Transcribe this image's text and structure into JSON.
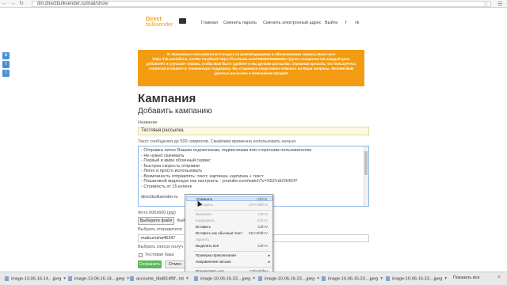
{
  "browser": {
    "url": "dm.directbulksender.ru/mail/show",
    "back_icon": "arrow-left",
    "forward_icon": "arrow-right",
    "reload_icon": "reload",
    "star_icon": "star",
    "menu_icon": "hamburger"
  },
  "site": {
    "logo_line1": "Direct",
    "logo_line2": "bulksender",
    "nav": [
      "Главная",
      "Сменить пароль",
      "Сменить электронный адрес",
      "Выйти"
    ],
    "social": [
      "f",
      "vk"
    ]
  },
  "notice": "!!! Уважаемые пользователи! Следите за рекомендациями и обновлениями сервиса Вконтакте https://vk.com/direct_sender Facebook https://facebook.com/106394766865481 Группа специалистов каждый день добавляет и улучшает сервис, чтобы Вам было удобнее и мы делаем рассылки. Огромная просьба, что пользуетесь сервисом и пишите в техническую поддержку. Мы стараемся оперативно отвечать на Ваши вопросы. Желаем Вам удачных рассылок и повышения продаж!",
  "page": {
    "title": "Кампания",
    "subtitle": "Добавить кампанию",
    "name_label": "Название",
    "name_value": "Тестовая рассылка",
    "text_label": "Текст сообщения до 500 символов. Смайлики временно использовать нельзя.",
    "text_lines": [
      "- Отправка лично Вашим подписчикам, подписчикам или сторонним пользователям",
      "- Не нужно скачивать",
      "- Первый в мире облачный сервис",
      "- Быстрая скорость отправки",
      "- Легко и просто использовать",
      "- Возможность отправлять: текст, картинка, картинка + текст",
      "- Пошаговый видеокурс как настроить - youtube.com/watch?v=X5ZVdU2H6OY",
      "- Стоимость от 15 копеек",
      "",
      "directbulksender.ru"
    ],
    "photo_label": "Фото 600x600 (jpg)",
    "choose_file": "Выберите файл",
    "file_after": "Фай",
    "sender_label": "Выбрать отправителя",
    "sender_value": "makuzmina46347",
    "list_label": "Выбрать список получ",
    "checkbox_label": "Тестовая база",
    "save_button": "Сохранить",
    "cancel_button": "Отмен"
  },
  "context_menu": [
    {
      "label": "Отменить",
      "shortcut": "Ctrl+Z",
      "state": "highlighted"
    },
    {
      "label": "Повторить",
      "shortcut": "Ctrl+Shift+Z",
      "state": "disabled"
    },
    {
      "label": "Вырезать",
      "shortcut": "Ctrl+X",
      "state": "disabled"
    },
    {
      "label": "Копировать",
      "shortcut": "Ctrl+C",
      "state": "disabled"
    },
    {
      "label": "Вставить",
      "shortcut": "Ctrl+V",
      "state": "normal"
    },
    {
      "label": "Вставить как обычный текст",
      "shortcut": "Ctrl+Shift+V",
      "state": "normal"
    },
    {
      "label": "Удалить",
      "shortcut": "",
      "state": "disabled"
    },
    {
      "label": "Выделить всё",
      "shortcut": "Ctrl+A",
      "state": "normal"
    },
    {
      "label": "Проверка правописания",
      "shortcut": "",
      "state": "submenu"
    },
    {
      "label": "Направление письма",
      "shortcut": "",
      "state": "submenu"
    },
    {
      "label": "Просмотреть код",
      "shortcut": "Ctrl+Shift+I",
      "state": "normal"
    }
  ],
  "downloads": [
    "image-13-06-16-14....jpeg",
    "image-13-06-16-14....jpeg",
    "accounts_6bd814f0f...txt",
    "image-10-06-16-23....jpeg",
    "image-10-06-16-23....jpeg",
    "image-10-06-16-23....jpeg",
    "image-10-06-16-23....jpeg"
  ],
  "downloads_show_all": "Показать все",
  "colors": {
    "notice_bg": "#f39c12",
    "save_bg": "#5cb85c",
    "name_input_bg": "#fcf8e3",
    "highlight": "#d6e6f7"
  }
}
